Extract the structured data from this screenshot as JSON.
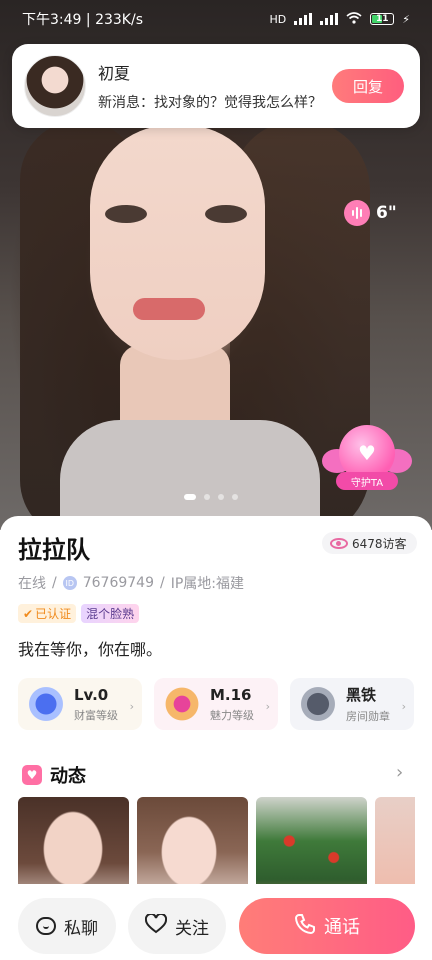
{
  "status_bar": {
    "time": "下午3:49",
    "speed": "233K/s",
    "network": "HD",
    "battery": "11"
  },
  "notification": {
    "name": "初夏",
    "message": "新消息：找对象的？觉得我怎么样？",
    "reply_label": "回复"
  },
  "voice": {
    "duration": "6\""
  },
  "guard": {
    "label": "守护TA"
  },
  "carousel": {
    "count": 4,
    "active": 0
  },
  "profile": {
    "username": "拉拉队",
    "visitors": "6478访客",
    "online": "在线",
    "id_label": "ID",
    "id": "76769749",
    "ip": "IP属地:福建",
    "tags": [
      "已认证",
      "混个脸熟"
    ],
    "signature": "我在等你，你在哪。"
  },
  "levels": [
    {
      "value": "Lv.0",
      "label": "财富等级"
    },
    {
      "value": "M.16",
      "label": "魅力等级"
    },
    {
      "value": "黑铁",
      "label": "房间勋章"
    }
  ],
  "moments": {
    "title": "动态"
  },
  "actions": {
    "chat": "私聊",
    "follow": "关注",
    "call": "通话"
  },
  "colors": {
    "accent": "#ff5e7e",
    "verified": "#f08a1c",
    "guard": "#ff5fb3"
  }
}
